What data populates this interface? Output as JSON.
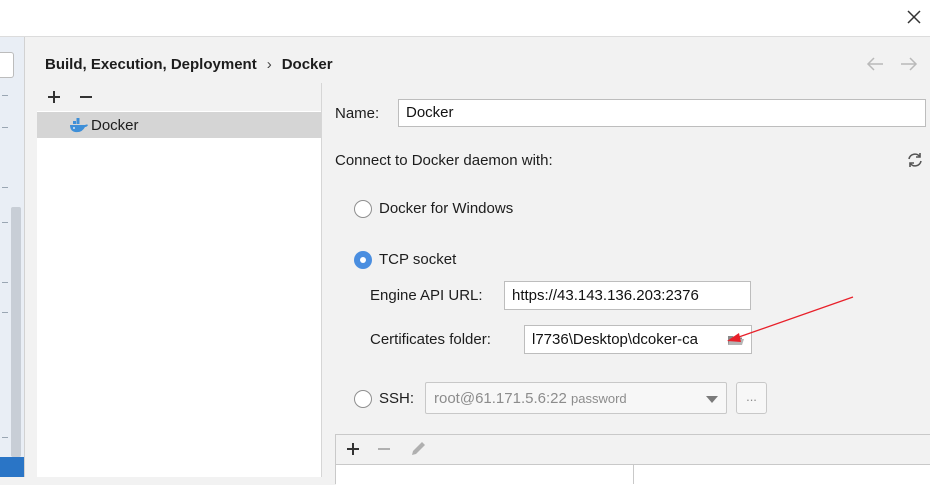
{
  "window": {
    "close_icon": "close-icon"
  },
  "breadcrumb": {
    "parent": "Build, Execution, Deployment",
    "separator": "›",
    "current": "Docker"
  },
  "nav": {
    "back_icon": "arrow-left-icon",
    "forward_icon": "arrow-right-icon"
  },
  "list_toolbar": {
    "add_icon": "plus-icon",
    "remove_icon": "minus-icon"
  },
  "docker_list": {
    "items": [
      {
        "label": "Docker",
        "icon": "docker-whale-icon"
      }
    ]
  },
  "form": {
    "name_label": "Name:",
    "name_value": "Docker",
    "connect_label": "Connect to Docker daemon with:",
    "refresh_icon": "refresh-icon",
    "options": {
      "docker_for_windows": {
        "label": "Docker for Windows",
        "selected": false
      },
      "tcp_socket": {
        "label": "TCP socket",
        "selected": true
      },
      "ssh": {
        "label": "SSH:",
        "selected": false
      }
    },
    "engine_api_label": "Engine API URL:",
    "engine_api_value": "https://43.143.136.203:2376",
    "certs_label": "Certificates folder:",
    "certs_value": "l7736\\Desktop\\dcoker-ca",
    "folder_icon": "folder-open-icon",
    "ssh_value": "root@61.171.5.6:22",
    "ssh_hint": "password",
    "ssh_browse_label": "..."
  },
  "mappings_toolbar": {
    "add_icon": "plus-icon",
    "remove_icon": "minus-icon",
    "edit_icon": "pencil-icon"
  },
  "colors": {
    "accent": "#4a8ee0",
    "selection": "#d5d5d5",
    "annotation": "#e8202a"
  }
}
